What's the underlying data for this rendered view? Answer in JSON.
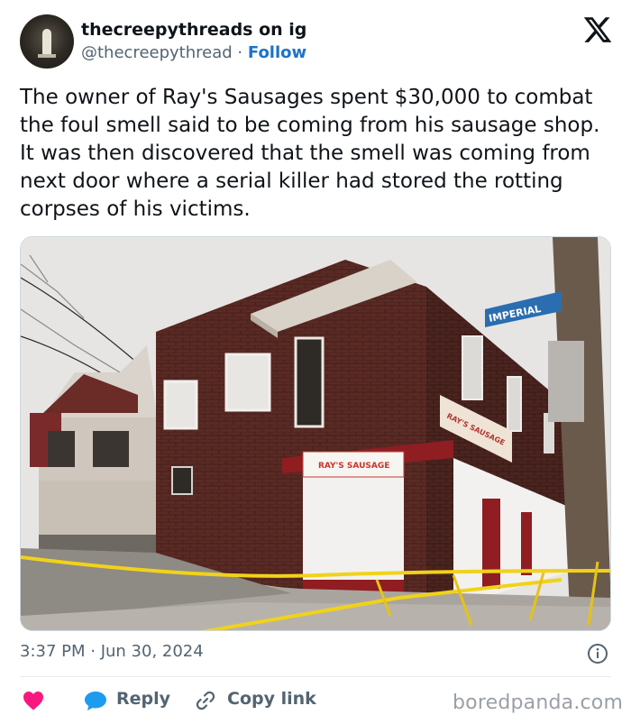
{
  "post": {
    "display_name": "thecreepythreads on ig",
    "handle": "@thecreepythread",
    "separator": "·",
    "follow_label": "Follow",
    "text": "The owner of Ray's Sausages spent $30,000 to combat the foul smell said to be coming from his sausage shop. It was then discovered that the smell was coming from next door where a serial killer had stored the rotting corpses of his victims.",
    "timestamp": "3:37 PM · Jun 30, 2024"
  },
  "photo": {
    "street_sign": "IMPERIAL",
    "shop_sign_front": "RAY'S SAUSAGE",
    "shop_sign_side": "RAY'S SAUSAGE"
  },
  "actions": {
    "reply_label": "Reply",
    "copy_link_label": "Copy link"
  },
  "watermark": "boredpanda.com",
  "icons": {
    "brand": "x-logo-icon",
    "like": "heart-icon",
    "reply": "speech-bubble-icon",
    "copy": "link-icon",
    "info": "info-icon"
  },
  "colors": {
    "follow": "#1d73c9",
    "heart": "#f91880",
    "reply": "#1d9bf0",
    "muted": "#536471"
  }
}
